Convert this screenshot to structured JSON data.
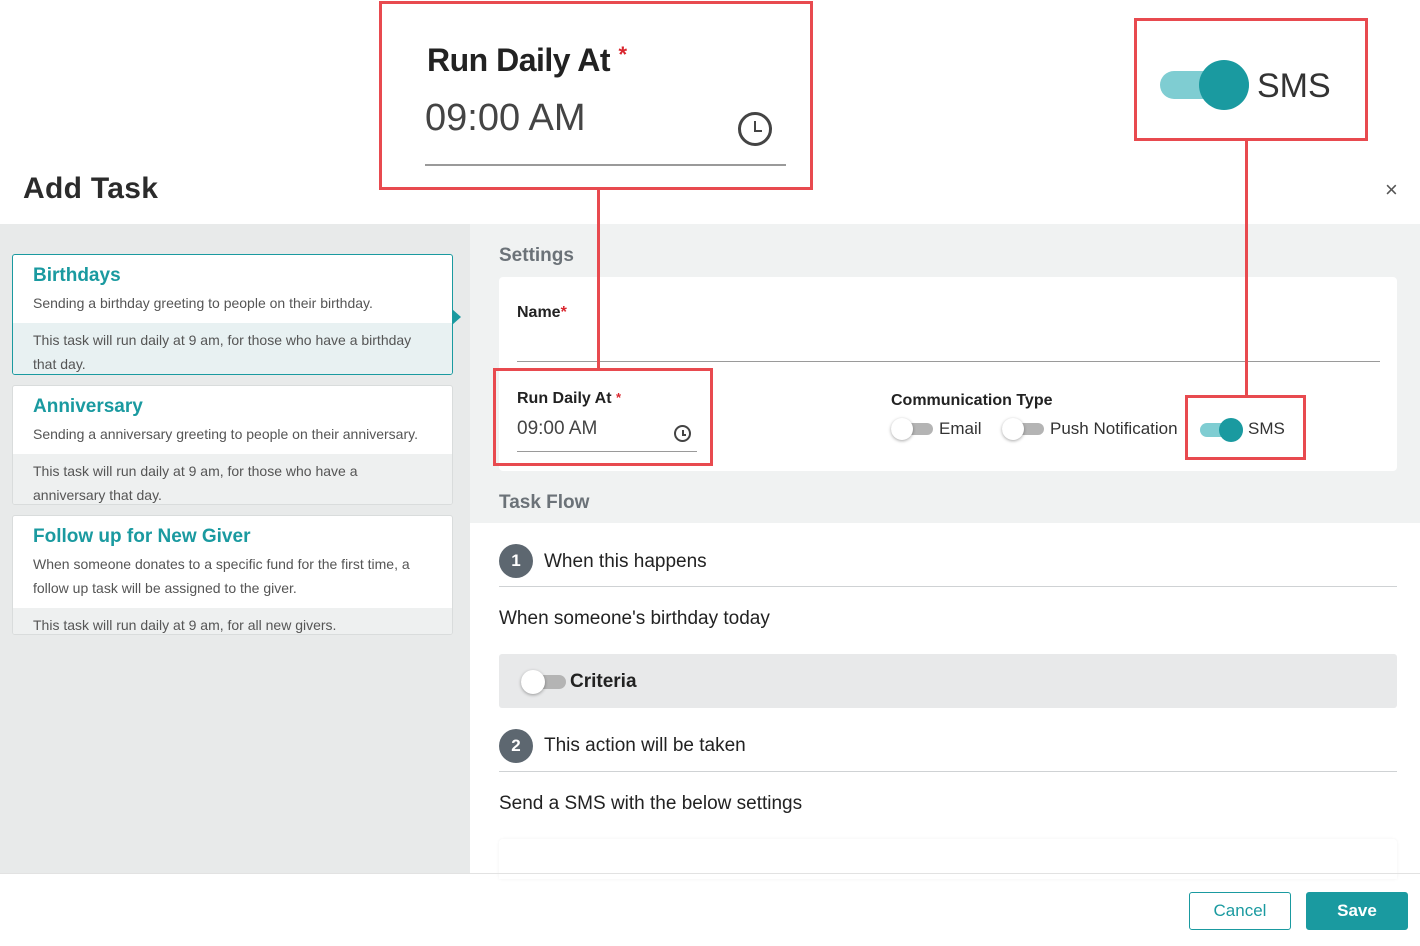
{
  "dialog": {
    "title": "Add Task",
    "close_glyph": "×"
  },
  "templates": [
    {
      "title": "Birthdays",
      "description": "Sending a birthday greeting to people on their birthday.",
      "schedule_line1": "This task will run daily at 9 am, for those who have a birthday",
      "schedule_line2": "that day."
    },
    {
      "title": "Anniversary",
      "description": "Sending a anniversary greeting to people on their anniversary.",
      "schedule_line1": "This task will run daily at 9 am, for those who have a",
      "schedule_line2": "anniversary that day."
    },
    {
      "title": "Follow up for New Giver",
      "description_line1": "When someone donates to a specific fund for the first time, a",
      "description_line2": "follow up task will be assigned to the giver.",
      "schedule_line1": "This task will run daily at 9 am, for all new givers."
    }
  ],
  "settings": {
    "heading": "Settings",
    "name_label": "Name",
    "name_value": "",
    "required_mark": "*",
    "run_daily_label": "Run Daily At",
    "run_daily_value": "09:00 AM",
    "communication_label": "Communication Type",
    "options": {
      "email": {
        "label": "Email",
        "on": false
      },
      "push": {
        "label": "Push Notification",
        "on": false
      },
      "sms": {
        "label": "SMS",
        "on": true
      }
    }
  },
  "task_flow": {
    "heading": "Task Flow",
    "step1_number": "1",
    "step1_title": "When this happens",
    "trigger_text": "When someone's birthday today",
    "criteria_label": "Criteria",
    "step2_number": "2",
    "step2_title": "This action will be taken",
    "action_text": "Send a SMS with the below settings"
  },
  "footer": {
    "cancel_label": "Cancel",
    "save_label": "Save"
  },
  "callouts": {
    "run_daily_label": "Run Daily At",
    "run_daily_value": "09:00 AM",
    "sms_label": "SMS"
  },
  "colors": {
    "accent": "#1a9aa0",
    "callout": "#e84a4f",
    "required": "#d9262e"
  },
  "icons": {
    "clock": "clock-icon",
    "close": "close-icon"
  }
}
